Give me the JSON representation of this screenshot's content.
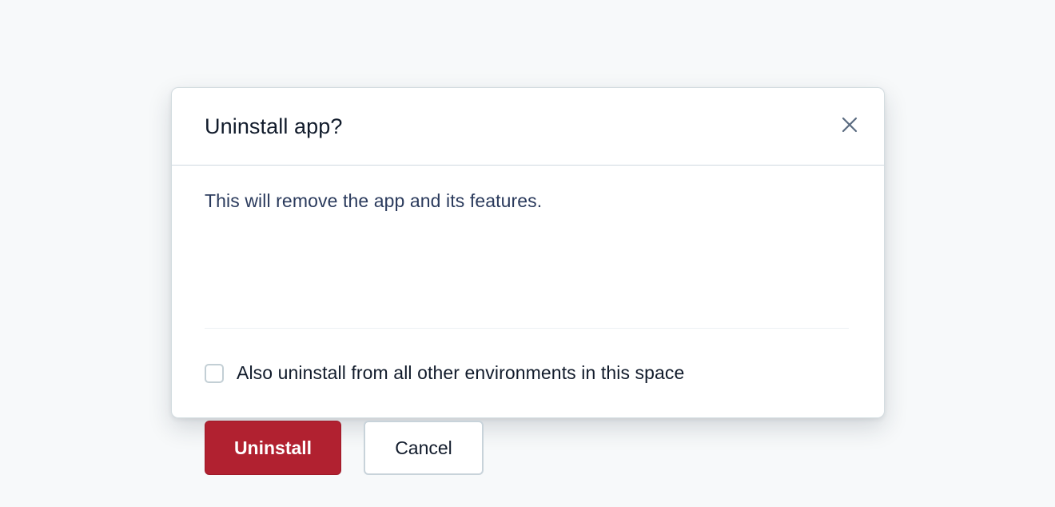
{
  "modal": {
    "title": "Uninstall app?",
    "close_icon": "close-icon",
    "description": "This will remove the app and its features.",
    "checkbox": {
      "label": "Also uninstall from all other environments in this space",
      "checked": false
    },
    "primary_button": {
      "label": "Uninstall",
      "color": "#b12130"
    },
    "secondary_button": {
      "label": "Cancel"
    }
  }
}
